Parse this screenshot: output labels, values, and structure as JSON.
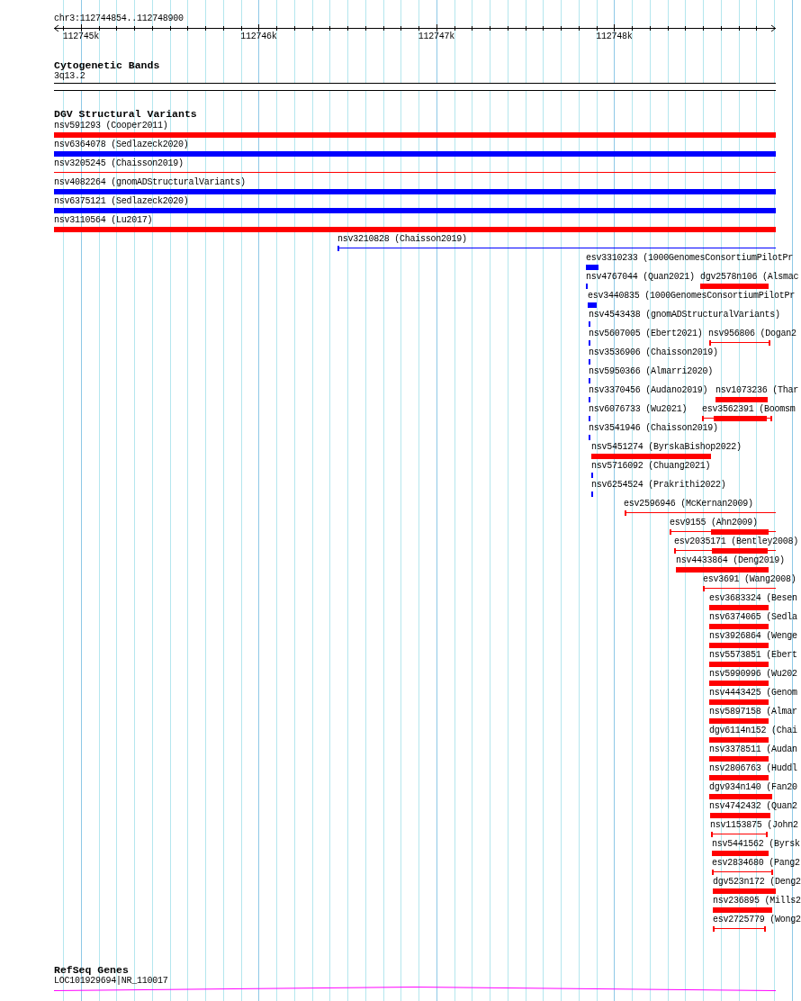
{
  "ruler": {
    "location": "chr3:112744854..112748900",
    "ticks": [
      "112745k",
      "112746k",
      "112747k",
      "112748k"
    ]
  },
  "tracks": [
    {
      "kind": "cytoband",
      "title": "Cytogenetic Bands",
      "bands": [
        {
          "label": "3q13.2"
        }
      ]
    },
    {
      "kind": "variants",
      "title": "DGV Structural Variants",
      "rows": [
        [
          {
            "label": "nsv591293 (Cooper2011)",
            "kind": "block",
            "color": "#ff0000"
          }
        ],
        [
          {
            "label": "nsv6364078 (Sedlazeck2020)",
            "kind": "block",
            "color": "#0000ff"
          }
        ],
        [
          {
            "label": "nsv3205245 (Chaisson2019)",
            "kind": "span",
            "color": "#ff0000"
          }
        ],
        [
          {
            "label": "nsv4082264 (gnomADStructuralVariants)",
            "kind": "block",
            "color": "#0000ff"
          }
        ],
        [
          {
            "label": "nsv6375121 (Sedlazeck2020)",
            "kind": "block",
            "color": "#0000ff"
          }
        ],
        [
          {
            "label": "nsv3110564 (Lu2017)",
            "kind": "block",
            "color": "#ff0000"
          }
        ],
        [
          {
            "label": "nsv3210828 (Chaisson2019)",
            "kind": "span",
            "color": "#0000ff"
          }
        ],
        [
          {
            "label": "esv3310233 (1000GenomesConsortiumPilotPr",
            "kind": "block",
            "color": "#0000ff"
          }
        ],
        [
          {
            "label": "nsv4767044 (Quan2021)",
            "kind": "block",
            "color": "#0000ff"
          },
          {
            "label": "dgv2578n106 (Alsmac",
            "kind": "block",
            "color": "#ff0000"
          }
        ],
        [
          {
            "label": "esv3440835 (1000GenomesConsortiumPilotPr",
            "kind": "block",
            "color": "#0000ff"
          }
        ],
        [
          {
            "label": "nsv4543438 (gnomADStructuralVariants)",
            "kind": "block",
            "color": "#0000ff"
          }
        ],
        [
          {
            "label": "nsv5607005 (Ebert2021)",
            "kind": "block",
            "color": "#0000ff"
          },
          {
            "label": "nsv956806 (Dogan2",
            "kind": "span",
            "color": "#ff0000"
          }
        ],
        [
          {
            "label": "nsv3536906 (Chaisson2019)",
            "kind": "block",
            "color": "#0000ff"
          }
        ],
        [
          {
            "label": "nsv5950366 (Almarri2020)",
            "kind": "block",
            "color": "#0000ff"
          }
        ],
        [
          {
            "label": "nsv3370456 (Audano2019)",
            "kind": "block",
            "color": "#0000ff"
          },
          {
            "label": "nsv1073236 (Thar",
            "kind": "block",
            "color": "#ff0000"
          }
        ],
        [
          {
            "label": "nsv6076733 (Wu2021)",
            "kind": "block",
            "color": "#0000ff"
          },
          {
            "label": "esv3562391 (Boomsm",
            "kind": "span-block",
            "color": "#ff0000"
          }
        ],
        [
          {
            "label": "nsv3541946 (Chaisson2019)",
            "kind": "block",
            "color": "#0000ff"
          }
        ],
        [
          {
            "label": "nsv5451274 (ByrskaBishop2022)",
            "kind": "block",
            "color": "#ff0000"
          }
        ],
        [
          {
            "label": "nsv5716092 (Chuang2021)",
            "kind": "block",
            "color": "#0000ff"
          }
        ],
        [
          {
            "label": "nsv6254524 (Prakrithi2022)",
            "kind": "block",
            "color": "#0000ff"
          }
        ],
        [
          {
            "label": "esv2596946 (McKernan2009)",
            "kind": "span",
            "color": "#ff0000"
          }
        ],
        [
          {
            "label": "esv9155 (Ahn2009)",
            "kind": "span-block",
            "color": "#ff0000"
          }
        ],
        [
          {
            "label": "esv2035171 (Bentley2008)",
            "kind": "span-block",
            "color": "#ff0000"
          }
        ],
        [
          {
            "label": "nsv4433864 (Deng2019)",
            "kind": "block",
            "color": "#ff0000"
          }
        ],
        [
          {
            "label": "esv3691 (Wang2008)",
            "kind": "span",
            "color": "#ff0000"
          }
        ],
        [
          {
            "label": "esv3683324 (Besen",
            "kind": "block",
            "color": "#ff0000"
          }
        ],
        [
          {
            "label": "nsv6374065 (Sedla",
            "kind": "block",
            "color": "#ff0000"
          }
        ],
        [
          {
            "label": "nsv3926864 (Wenge",
            "kind": "block",
            "color": "#ff0000"
          }
        ],
        [
          {
            "label": "nsv5573851 (Ebert",
            "kind": "block",
            "color": "#ff0000"
          }
        ],
        [
          {
            "label": "nsv5990996 (Wu202",
            "kind": "block",
            "color": "#ff0000"
          }
        ],
        [
          {
            "label": "nsv4443425 (Genom",
            "kind": "block",
            "color": "#ff0000"
          }
        ],
        [
          {
            "label": "nsv5897158 (Almar",
            "kind": "block",
            "color": "#ff0000"
          }
        ],
        [
          {
            "label": "dgv6114n152 (Chai",
            "kind": "block",
            "color": "#ff0000"
          }
        ],
        [
          {
            "label": "nsv3378511 (Audan",
            "kind": "block",
            "color": "#ff0000"
          }
        ],
        [
          {
            "label": "nsv2806763 (Huddl",
            "kind": "block",
            "color": "#ff0000"
          }
        ],
        [
          {
            "label": "dgv934n140 (Fan20",
            "kind": "block",
            "color": "#ff0000"
          }
        ],
        [
          {
            "label": "nsv4742432 (Quan2",
            "kind": "block",
            "color": "#ff0000"
          }
        ],
        [
          {
            "label": "nsv1153875 (John2",
            "kind": "span",
            "color": "#ff0000"
          }
        ],
        [
          {
            "label": "nsv5441562 (Byrsk",
            "kind": "block",
            "color": "#ff0000"
          }
        ],
        [
          {
            "label": "esv2834680 (Pang2",
            "kind": "span",
            "color": "#ff0000"
          }
        ],
        [
          {
            "label": "dgv523n172 (Deng2",
            "kind": "block",
            "color": "#ff0000"
          }
        ],
        [
          {
            "label": "nsv236895 (Mills2",
            "kind": "block",
            "color": "#ff0000"
          }
        ],
        [
          {
            "label": "esv2725779 (Wong2",
            "kind": "span",
            "color": "#ff0000"
          }
        ]
      ]
    },
    {
      "kind": "genes",
      "title": "RefSeq Genes",
      "genes": [
        {
          "label": "LOC101929694|NR_110017"
        }
      ]
    }
  ]
}
